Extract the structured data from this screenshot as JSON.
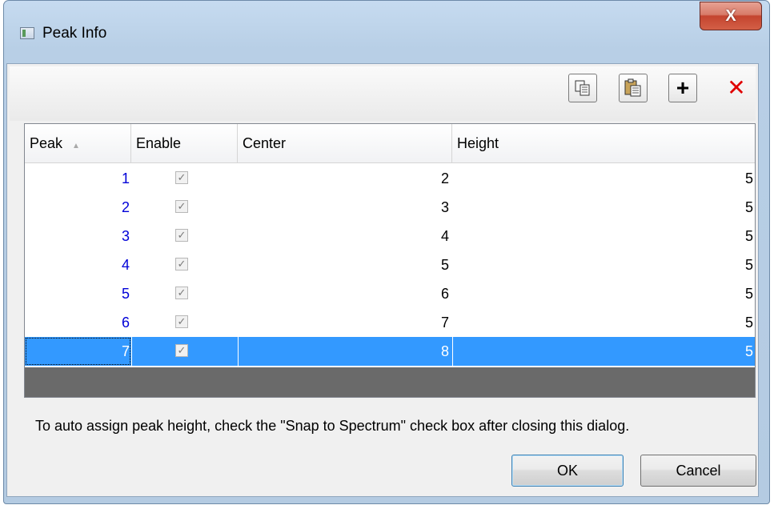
{
  "window": {
    "title": "Peak Info",
    "close_label": "X"
  },
  "toolbar": {
    "copy_icon": "copy-icon",
    "paste_icon": "paste-icon",
    "add_label": "+",
    "delete_label": "✕"
  },
  "grid": {
    "columns": [
      "Peak",
      "Enable",
      "Center",
      "Height"
    ],
    "sorted_column": "Peak",
    "rows": [
      {
        "peak": "1",
        "enabled": true,
        "center": "2",
        "height": "5"
      },
      {
        "peak": "2",
        "enabled": true,
        "center": "3",
        "height": "5"
      },
      {
        "peak": "3",
        "enabled": true,
        "center": "4",
        "height": "5"
      },
      {
        "peak": "4",
        "enabled": true,
        "center": "5",
        "height": "5"
      },
      {
        "peak": "5",
        "enabled": true,
        "center": "6",
        "height": "5"
      },
      {
        "peak": "6",
        "enabled": true,
        "center": "7",
        "height": "5"
      },
      {
        "peak": "7",
        "enabled": true,
        "center": "8",
        "height": "5"
      }
    ],
    "selected_row": 7
  },
  "hint_text": "To auto assign peak height, check the \"Snap to Spectrum\" check box after closing this dialog.",
  "buttons": {
    "ok": "OK",
    "cancel": "Cancel"
  },
  "colors": {
    "selection": "#3399ff",
    "peak_number": "#0000d8",
    "delete": "#e00000"
  }
}
